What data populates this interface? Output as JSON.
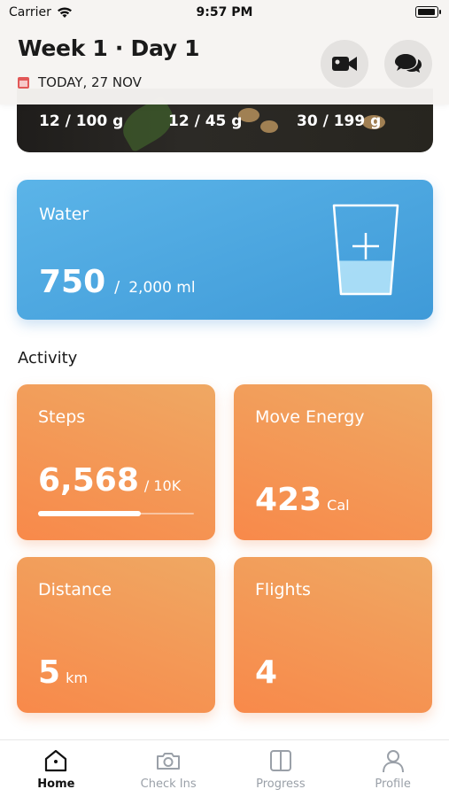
{
  "status_bar": {
    "carrier": "Carrier",
    "time": "9:57 PM"
  },
  "header": {
    "title": "Week 1 · Day 1",
    "date": "TODAY, 27 NOV",
    "buttons": [
      {
        "icon": "video-camera-icon"
      },
      {
        "icon": "chat-bubbles-icon"
      }
    ]
  },
  "nutrition": {
    "stats": [
      "12 / 100 g",
      "12 / 45 g",
      "30 / 199 g"
    ]
  },
  "water": {
    "label": "Water",
    "value": "750",
    "separator": "/",
    "goal": "2,000 ml",
    "fill_fraction": 0.375
  },
  "activity": {
    "title": "Activity",
    "steps": {
      "label": "Steps",
      "value": "6,568",
      "goal": "/ 10K",
      "progress": 0.66
    },
    "move": {
      "label": "Move Energy",
      "value": "423",
      "unit": "Cal"
    },
    "distance": {
      "label": "Distance",
      "value": "5",
      "unit": "km"
    },
    "flights": {
      "label": "Flights",
      "value": "4"
    }
  },
  "tab_bar": {
    "items": [
      {
        "label": "Home",
        "icon": "home-icon",
        "active": true
      },
      {
        "label": "Check Ins",
        "icon": "camera-icon",
        "active": false
      },
      {
        "label": "Progress",
        "icon": "progress-book-icon",
        "active": false
      },
      {
        "label": "Profile",
        "icon": "person-icon",
        "active": false
      }
    ]
  },
  "colors": {
    "water_card": "#4aa6e0",
    "activity_tile": "#f4955a",
    "tab_active": "#111111",
    "tab_inactive": "#9aa0a8"
  }
}
